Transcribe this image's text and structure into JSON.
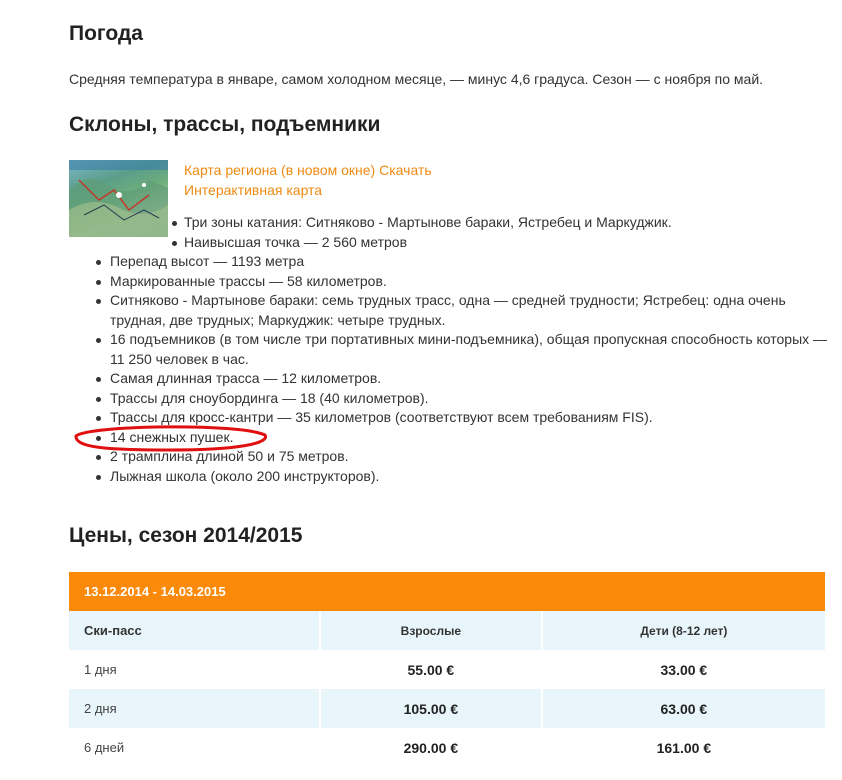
{
  "weather": {
    "title": "Погода",
    "text": "Средняя температура в январе, самом холодном месяце, — минус 4,6 градуса. Сезон — с ноября по май."
  },
  "slopes": {
    "title": "Склоны, трассы, подъемники",
    "map_links": {
      "region_map": "Карта региона (в новом окне)",
      "download": "Скачать",
      "interactive": "Интерактивная карта"
    },
    "features": [
      "Три зоны катания: Ситняково - Мартынове бараки, Ястребец и Маркуджик.",
      "Наивысшая точка — 2 560 метров",
      "Перепад высот — 1193 метра",
      "Маркированные трассы — 58 километров.",
      "Ситняково - Мартынове бараки: семь трудных трасс, одна — средней трудности; Ястребец: одна очень трудная, две трудных; Маркуджик: четыре трудных.",
      "16 подъемников (в том числе три портативных мини-подъемника), общая пропускная способность которых — 11 250 человек в час.",
      "Самая длинная трасса — 12 километров.",
      "Трассы для сноубординга — 18 (40 километров).",
      "Трассы для кросс-кантри — 35 километров (соответствуют всем требованиям FIS).",
      "14 снежных пушек.",
      "2 трамплина длиной 50 и 75 метров.",
      "Лыжная школа (около 200 инструкторов)."
    ]
  },
  "prices": {
    "title": "Цены, сезон 2014/2015",
    "season": "13.12.2014 - 14.03.2015",
    "headers": [
      "Ски-пасс",
      "Взрослые",
      "Дети (8-12 лет)"
    ],
    "rows": [
      [
        "1 дня",
        "55.00 €",
        "33.00 €"
      ],
      [
        "2 дня",
        "105.00 €",
        "63.00 €"
      ],
      [
        "6 дней",
        "290.00 €",
        "161.00 €"
      ]
    ]
  },
  "colors": {
    "accent_orange": "#fb8a0b",
    "link_orange": "#ee8a13",
    "row_alt": "#e8f5fb",
    "annotation_red": "#e01010"
  }
}
